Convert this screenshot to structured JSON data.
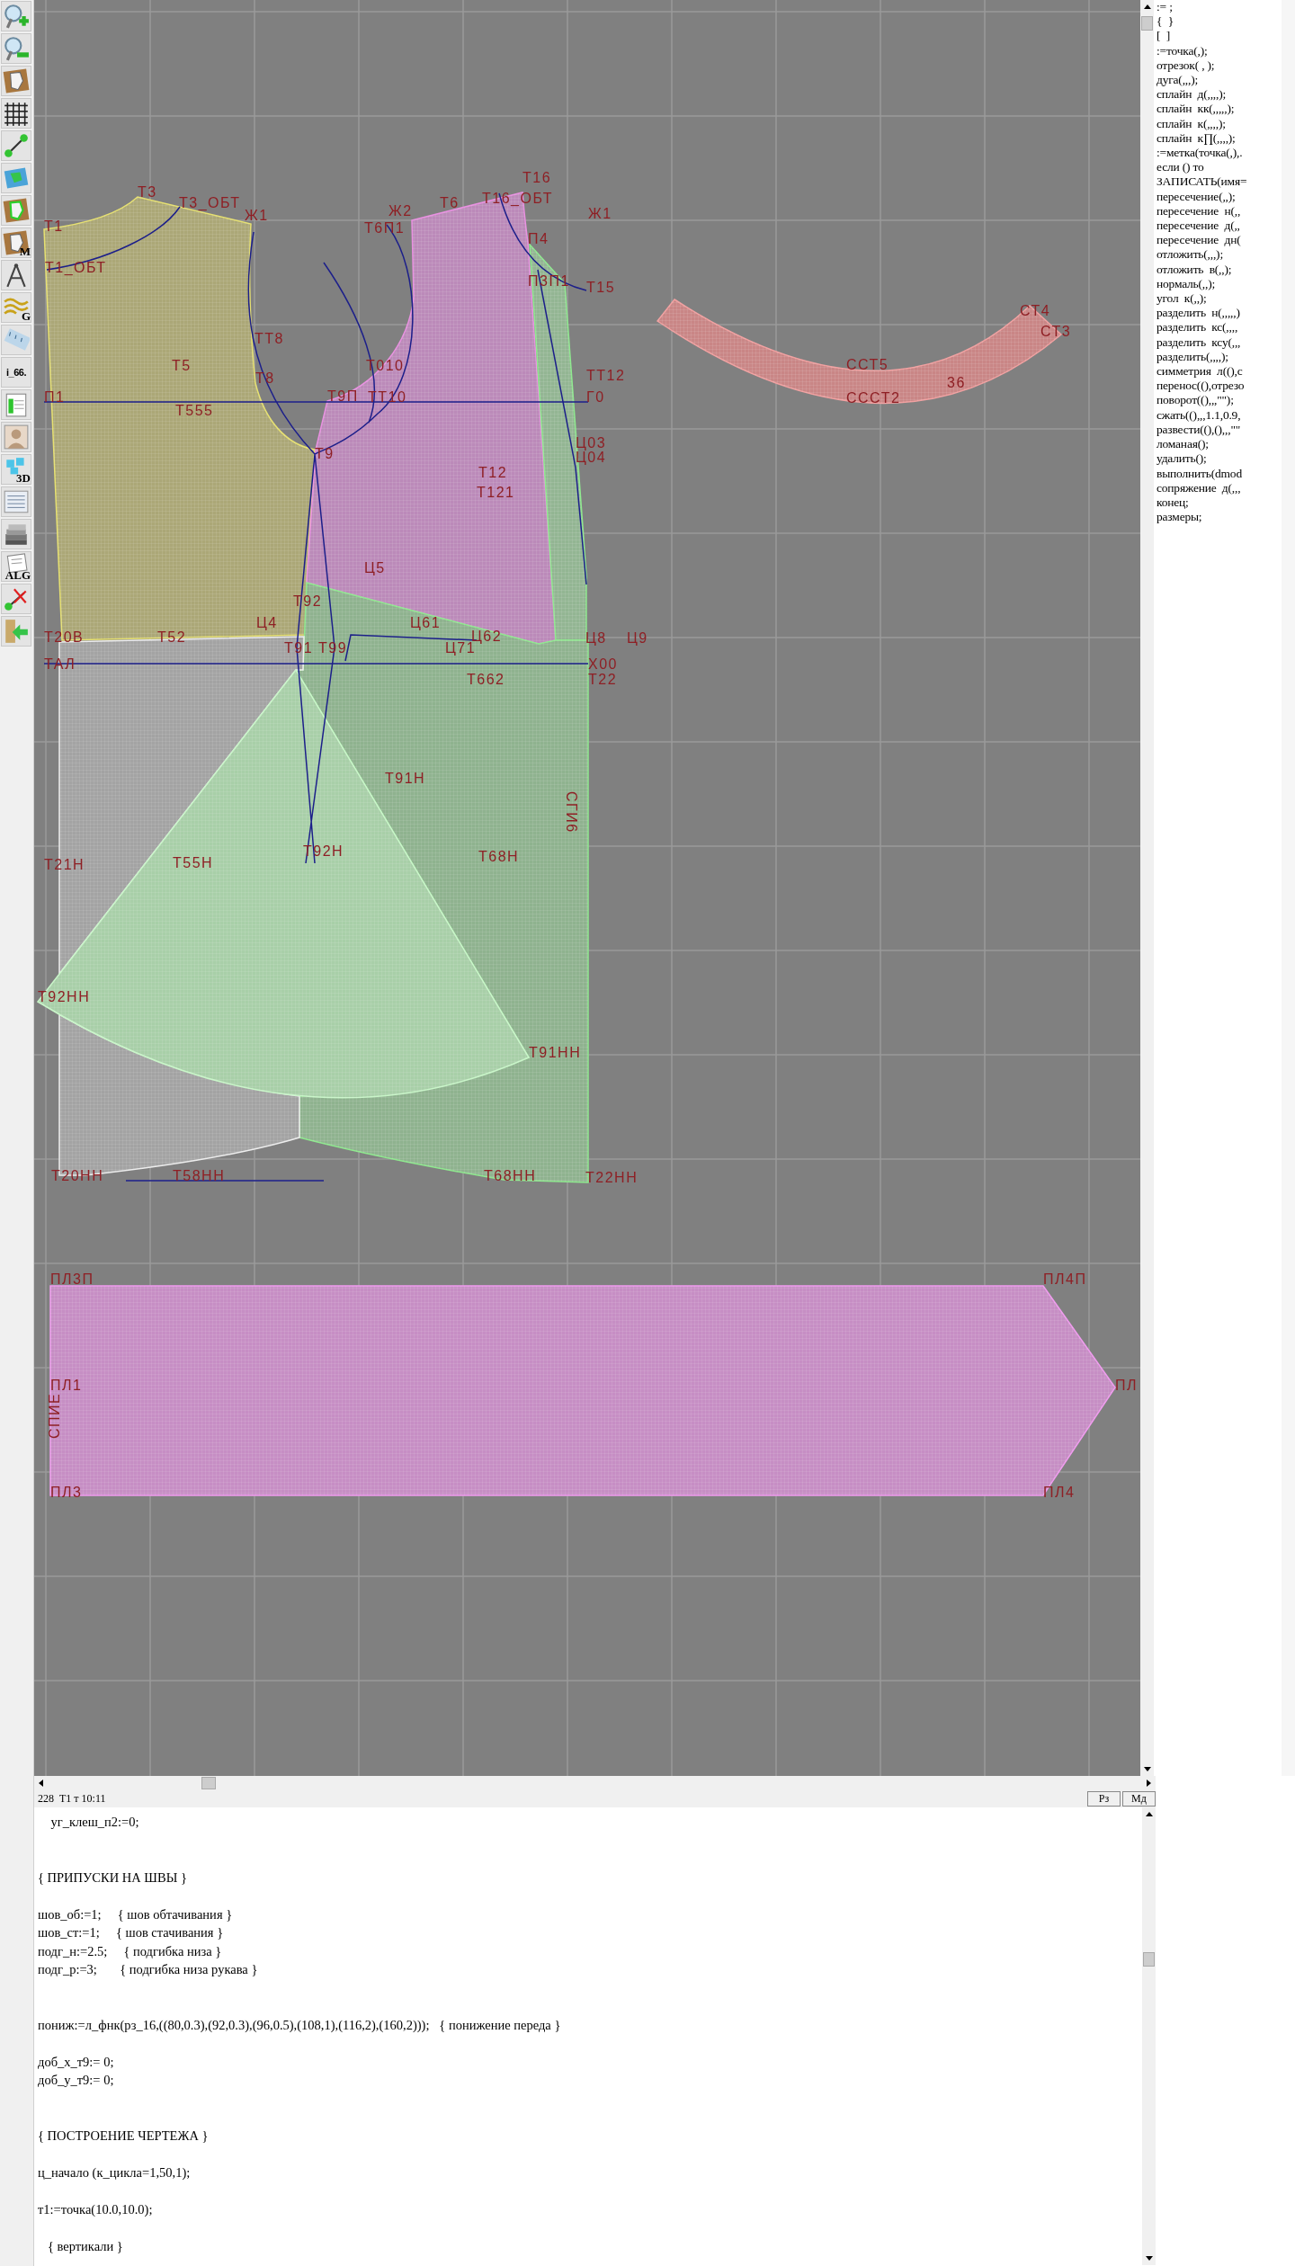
{
  "toolbar": [
    {
      "kind": "zoom-in"
    },
    {
      "kind": "zoom-out"
    },
    {
      "kind": "piece"
    },
    {
      "kind": "grid"
    },
    {
      "kind": "segment"
    },
    {
      "kind": "layout"
    },
    {
      "kind": "outline"
    },
    {
      "kind": "piece",
      "label": "M"
    },
    {
      "kind": "compass"
    },
    {
      "kind": "wave",
      "label": "G"
    },
    {
      "kind": "ruler"
    },
    {
      "kind": "text",
      "label": "i_66."
    },
    {
      "kind": "sheet"
    },
    {
      "kind": "person"
    },
    {
      "kind": "cubes",
      "label": "3D"
    },
    {
      "kind": "list"
    },
    {
      "kind": "books"
    },
    {
      "kind": "doc",
      "label": "ALG"
    },
    {
      "kind": "cross"
    },
    {
      "kind": "exit"
    }
  ],
  "drawing": {
    "labels": [
      "Т16",
      "Т3",
      "Т3_ОБТ",
      "Т6",
      "Т16_ОБТ",
      "Ж1",
      "Ж2",
      "Ж1",
      "Т1",
      "Т6П1",
      "П4",
      "Т1_ОБТ",
      "П3П1",
      "Т15",
      "СТ4",
      "СТ3",
      "ТТ8",
      "Т5",
      "Т8",
      "Т010",
      "ТТ12",
      "ССТ5",
      "36",
      "П1",
      "Т9П",
      "ТТ10",
      "Г0",
      "СССТ2",
      "Т555",
      "Т9",
      "Ц03",
      "Ц04",
      "Т12",
      "Т121",
      "Ц5",
      "Т92",
      "Ц4",
      "Ц61",
      "Т20В",
      "Т52",
      "Ц62",
      "Ц8",
      "Ц9",
      "Т91",
      "Т99",
      "Ц71",
      "ТАЛ",
      "Х00",
      "Т662",
      "Т22",
      "Т91Н",
      "СГИ6",
      "Т21Н",
      "Т55Н",
      "Т92Н",
      "Т68Н",
      "Т92НН",
      "Т91НН",
      "Т20НН",
      "Т58НН",
      "Т68НН",
      "Т22НН",
      "ПЛ3П",
      "ПЛ4П",
      "ПЛ1",
      "ПЛ",
      "СПИЕ",
      "ПЛ3",
      "ПЛ4"
    ]
  },
  "command_list": [
    ":= ;",
    "{  }",
    "[  ]",
    ":=точка(,);",
    "отрезок( , );",
    "дуга(,,,);",
    "сплайн  д(,,,,);",
    "сплайн  кк(,,,,,);",
    "сплайн  к(,,,,);",
    "сплайн  к∏(,,,,);",
    ":=метка(точка(,),.",
    "если () то",
    "ЗАПИСАТЬ(имя=",
    "пересечение(,,);",
    "пересечение  н(,,",
    "пересечение  д(,,",
    "пересечение  дн(",
    "отложить(,,,);",
    "отложить  в(,,);",
    "нормаль(,,);",
    "угол  к(,,);",
    "разделить  н(,,,,,)",
    "разделить  кс(,,,,",
    "разделить  ксу(,,,",
    "разделить(,,,,);",
    "симметрия  л((),с",
    "перенос((),отрезо",
    "поворот((),,,\"\");",
    "сжать((),,,1.1,0.9,",
    "развести((),(),,,\"\"",
    "ломаная();",
    "удалить();",
    "выполнить(dmod",
    "сопряжение  д(,,,",
    "конец;",
    "размеры;"
  ],
  "status_bar": {
    "text": "228  Т1 т 10:11",
    "buttons": [
      "Рз",
      "Мд"
    ]
  },
  "editor": {
    "sections": [
      {
        "blocks": [
          [
            "    уг_клеш_п2:=0;"
          ]
        ]
      },
      {
        "blocks": [
          [
            "{ ПРИПУСКИ НА ШВЫ }"
          ],
          [
            "шов_об:=1;     { шов обтачивания }",
            "шов_ст:=1;     { шов стачивания }",
            "подг_н:=2.5;     { подгибка низа }",
            "подг_р:=3;       { подгибка низа рукава }"
          ]
        ]
      },
      {
        "blocks": [
          [
            "пониж:=л_фнк(рз_16,((80,0.3),(92,0.3),(96,0.5),(108,1),(116,2),(160,2)));   { понижение переда }"
          ],
          [
            "доб_х_т9:= 0;",
            "доб_у_т9:= 0;"
          ]
        ]
      },
      {
        "blocks": [
          [
            "{ ПОСТРОЕНИЕ ЧЕРТЕЖА }"
          ],
          [
            "ц_начало (к_цикла=1,50,1);"
          ],
          [
            "т1:=точка(10.0,10.0);"
          ],
          [
            "   { вертикали }"
          ]
        ]
      }
    ]
  }
}
